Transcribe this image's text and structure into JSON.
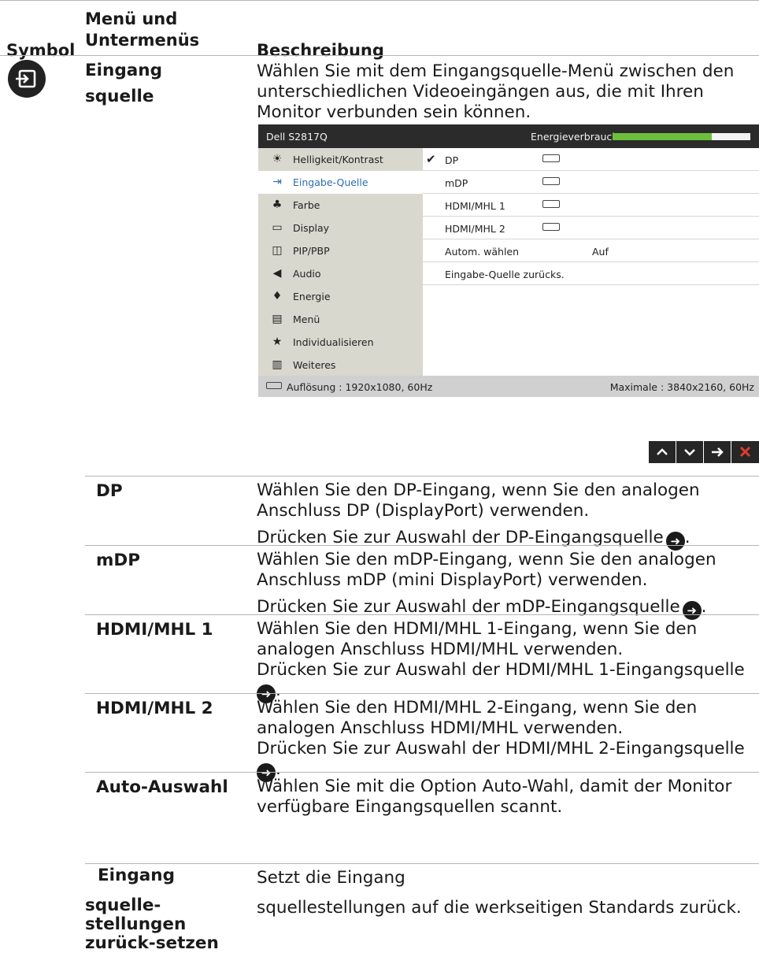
{
  "header": {
    "col_symbol": "Symbol",
    "col_menu_line1": "Menü und",
    "col_menu_line2": "Untermenüs",
    "col_desc": "Beschreibung"
  },
  "section": {
    "icon": "input-source-icon",
    "title_line1": "Eingang",
    "title_line2": "squelle",
    "desc_line1": "Wählen Sie mit dem Eingangsquelle-Menü zwischen den",
    "desc_line2": "unterschiedlichen Videoeingängen aus, die mit Ihren",
    "desc_line3": "Monitor verbunden sein können."
  },
  "osd": {
    "title": "Dell S2817Q",
    "energy_label": "Energieverbrauch",
    "energy_level": 0.72,
    "menu": [
      {
        "label": "Helligkeit/Kontrast",
        "icon": "brightness-icon",
        "glyph": "☀",
        "selected": false
      },
      {
        "label": "Eingabe-Quelle",
        "icon": "input-source-icon",
        "glyph": "⇥",
        "selected": true
      },
      {
        "label": "Farbe",
        "icon": "color-icon",
        "glyph": "♣",
        "selected": false
      },
      {
        "label": "Display",
        "icon": "display-icon",
        "glyph": "▭",
        "selected": false
      },
      {
        "label": "PIP/PBP",
        "icon": "pip-icon",
        "glyph": "◫",
        "selected": false
      },
      {
        "label": "Audio",
        "icon": "speaker-icon",
        "glyph": "◀",
        "selected": false
      },
      {
        "label": "Energie",
        "icon": "energy-icon",
        "glyph": "♦",
        "selected": false
      },
      {
        "label": "Menü",
        "icon": "menu-icon",
        "glyph": "▤",
        "selected": false
      },
      {
        "label": "Individualisieren",
        "icon": "star-icon",
        "glyph": "★",
        "selected": false
      },
      {
        "label": "Weiteres",
        "icon": "others-icon",
        "glyph": "▥",
        "selected": false
      }
    ],
    "options": [
      {
        "label": "DP",
        "checked": true,
        "port": true,
        "value": ""
      },
      {
        "label": "mDP",
        "checked": false,
        "port": true,
        "value": ""
      },
      {
        "label": "HDMI/MHL 1",
        "checked": false,
        "port": true,
        "value": ""
      },
      {
        "label": "HDMI/MHL 2",
        "checked": false,
        "port": true,
        "value": ""
      },
      {
        "label": "Autom. wählen",
        "checked": false,
        "port": false,
        "value": "Auf"
      },
      {
        "label": "Eingabe-Quelle zurücks.",
        "checked": false,
        "port": false,
        "value": ""
      }
    ],
    "footer_left": "Auflösung : 1920x1080, 60Hz",
    "footer_right": "Maximale : 3840x2160, 60Hz"
  },
  "nav": {
    "up": "^",
    "down": "v",
    "enter": "→",
    "close": "✕",
    "close_color": "#e03c2e"
  },
  "rows": [
    {
      "name": "DP",
      "lines": [
        "Wählen Sie den DP-Eingang, wenn Sie den analogen",
        "Anschluss DP (DisplayPort) verwenden."
      ],
      "press": "Drücken Sie zur Auswahl der DP-Eingangsquelle"
    },
    {
      "name": "mDP",
      "lines": [
        "Wählen Sie den mDP-Eingang, wenn Sie den analogen",
        "Anschluss mDP (mini DisplayPort) verwenden."
      ],
      "press": "Drücken Sie zur Auswahl der mDP-Eingangsquelle"
    },
    {
      "name": "HDMI/MHL 1",
      "lines": [
        "Wählen Sie den HDMI/MHL 1-Eingang, wenn Sie den",
        "analogen Anschluss HDMI/MHL verwenden."
      ],
      "press": "Drücken Sie zur Auswahl der HDMI/MHL 1-Eingangsquelle"
    },
    {
      "name": "HDMI/MHL 2",
      "lines": [
        "Wählen Sie den HDMI/MHL 2-Eingang, wenn Sie den",
        "analogen Anschluss HDMI/MHL verwenden."
      ],
      "press": "Drücken Sie zur Auswahl der HDMI/MHL 2-Eingangsquelle"
    },
    {
      "name": "Auto-Auswahl",
      "lines": [
        "Wählen Sie mit die Option Auto-Wahl, damit der Monitor",
        "verfügbare Eingangsquellen scannt."
      ],
      "press": ""
    }
  ],
  "reset": {
    "name_lines": [
      "Eingang",
      "squelle-",
      "stellungen",
      "zurück-setzen"
    ],
    "desc_line1": "Setzt die Eingang",
    "desc_line2": "squellestellungen auf die werkseitigen Standards zurück."
  }
}
